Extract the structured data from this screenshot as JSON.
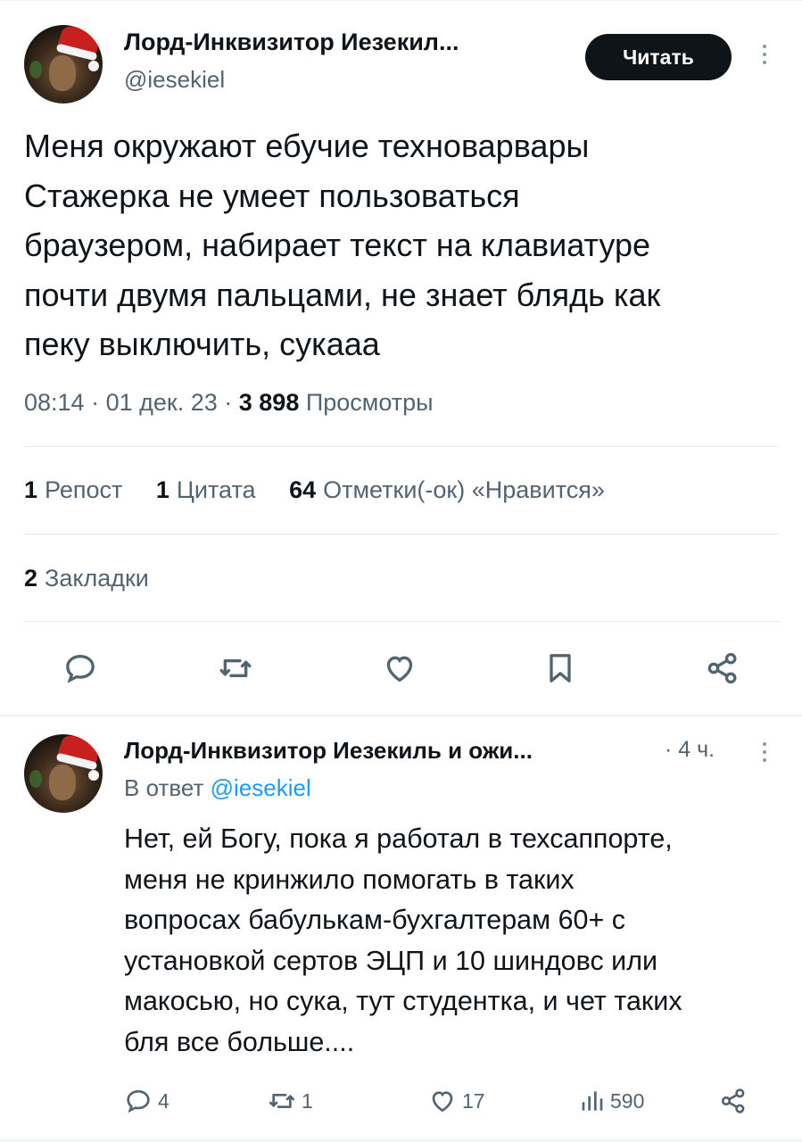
{
  "main": {
    "author_name": "Лорд-Инквизитор Иезекил...",
    "handle": "@iesekiel",
    "follow_label": "Читать",
    "text": "Меня окружают ебучие техноварвары\nСтажерка не умеет пользоваться\nбраузером, набирает текст на клавиатуре\nпочти двумя пальцами, не знает блядь как\nпеку выключить, сукааа",
    "time": "08:14",
    "date": "01 дек. 23",
    "views_count": "3 898",
    "views_label": "Просмотры",
    "reposts_count": "1",
    "reposts_label": "Репост",
    "quotes_count": "1",
    "quotes_label": "Цитата",
    "likes_count": "64",
    "likes_label": "Отметки(-ок) «Нравится»",
    "bookmarks_count": "2",
    "bookmarks_label": "Закладки"
  },
  "reply": {
    "author_name": "Лорд-Инквизитор Иезекиль и ожи...",
    "time_ago": "· 4 ч.",
    "in_reply_prefix": "В ответ",
    "in_reply_handle": "@iesekiel",
    "text": "Нет, ей Богу, пока я работал в техсаппорте,\nменя не кринжило помогать в таких\nвопросах бабулькам-бухгалтерам 60+ с\nустановкой сертов ЭЦП и 10 шиндовс или\nмакосью, но сука, тут студентка, и чет таких\nбля все больше....",
    "replies": "4",
    "retweets": "1",
    "likes": "17",
    "views": "590"
  },
  "icons": {
    "reply": "reply-icon",
    "retweet": "retweet-icon",
    "like": "heart-icon",
    "bookmark": "bookmark-icon",
    "share": "share-icon",
    "views": "views-icon",
    "more": "more-icon"
  },
  "colors": {
    "text": "#0f1419",
    "secondary": "#536471",
    "link": "#1d9bf0",
    "button_bg": "#0f1419"
  }
}
